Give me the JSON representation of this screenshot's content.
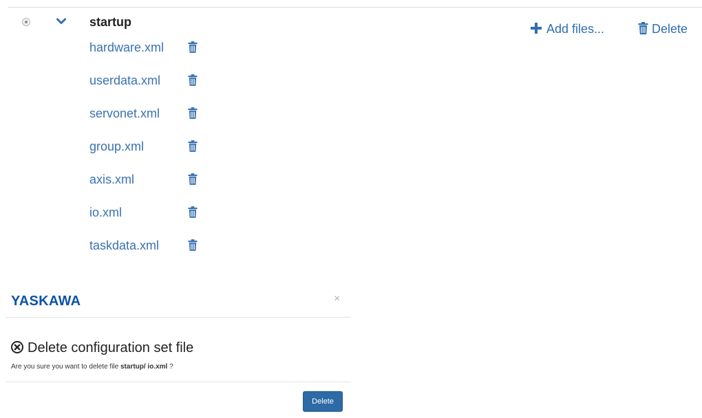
{
  "config_set": {
    "name": "startup",
    "files": [
      {
        "name": "hardware.xml"
      },
      {
        "name": "userdata.xml"
      },
      {
        "name": "servonet.xml"
      },
      {
        "name": "group.xml"
      },
      {
        "name": "axis.xml"
      },
      {
        "name": "io.xml"
      },
      {
        "name": "taskdata.xml"
      }
    ],
    "add_files_label": "Add files...",
    "delete_label": "Delete"
  },
  "modal": {
    "brand": "YASKAWA",
    "close_glyph": "×",
    "title": "Delete configuration set file",
    "message_prefix": "Are you sure you want to delete file ",
    "message_file": "startup/ io.xml",
    "message_suffix": " ?",
    "delete_button": "Delete"
  },
  "colors": {
    "link": "#3a72b0",
    "brand": "#0b52a8",
    "primary_button": "#2d6aa6"
  },
  "icons": {
    "select": "radio-icon",
    "expand": "chevron-down-icon",
    "file_delete": "trash-icon",
    "add": "plus-icon",
    "modal_title": "circle-x-icon",
    "close": "close-icon"
  }
}
